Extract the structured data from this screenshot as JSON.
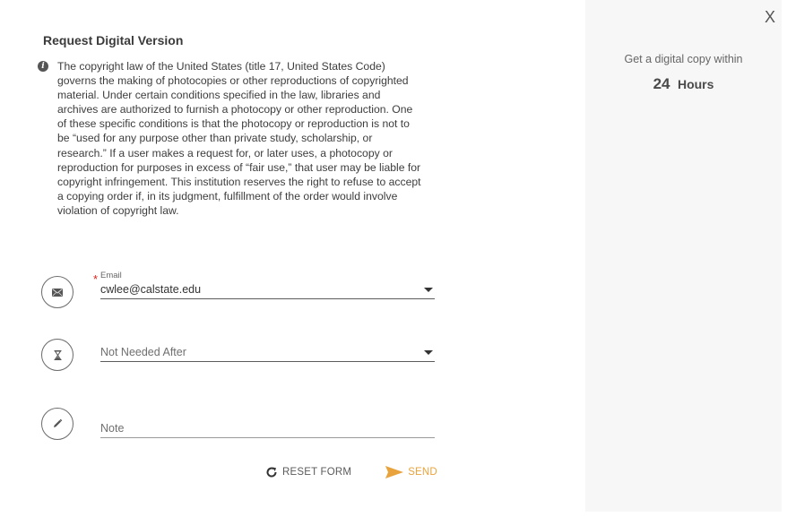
{
  "dialog": {
    "title": "Request Digital Version",
    "notice_icon": "info-icon",
    "copyright_notice": "The copyright law of the United States (title 17, United States Code) governs the making of photocopies or other reproductions of copyrighted material. Under certain conditions specified in the law, libraries and archives are authorized to furnish a photocopy or other reproduction. One of these specific conditions is that the photocopy or reproduction is not to be “used for any purpose other than private study, scholarship, or research.” If a user makes a request for, or later uses, a photocopy or reproduction for purposes in excess of “fair use,” that user may be liable for copyright infringement. This institution reserves the right to refuse to accept a copying order if, in its judgment, fulfillment of the order would involve violation of copyright law."
  },
  "form": {
    "email": {
      "icon": "envelope-icon",
      "label": "Email",
      "required_marker": "*",
      "value": "cwlee@calstate.edu"
    },
    "not_needed_after": {
      "icon": "hourglass-icon",
      "placeholder": "Not Needed After"
    },
    "note": {
      "icon": "pencil-icon",
      "placeholder": "Note"
    },
    "actions": {
      "reset_label": "RESET FORM",
      "send_label": "SEND"
    }
  },
  "side_panel": {
    "close_label": "X",
    "promo_text": "Get a digital copy within",
    "promo_number": "24",
    "promo_unit": "Hours"
  },
  "colors": {
    "accent": "#e8a33d",
    "required": "#e0211b",
    "panel_bg": "#f7f7f7"
  }
}
